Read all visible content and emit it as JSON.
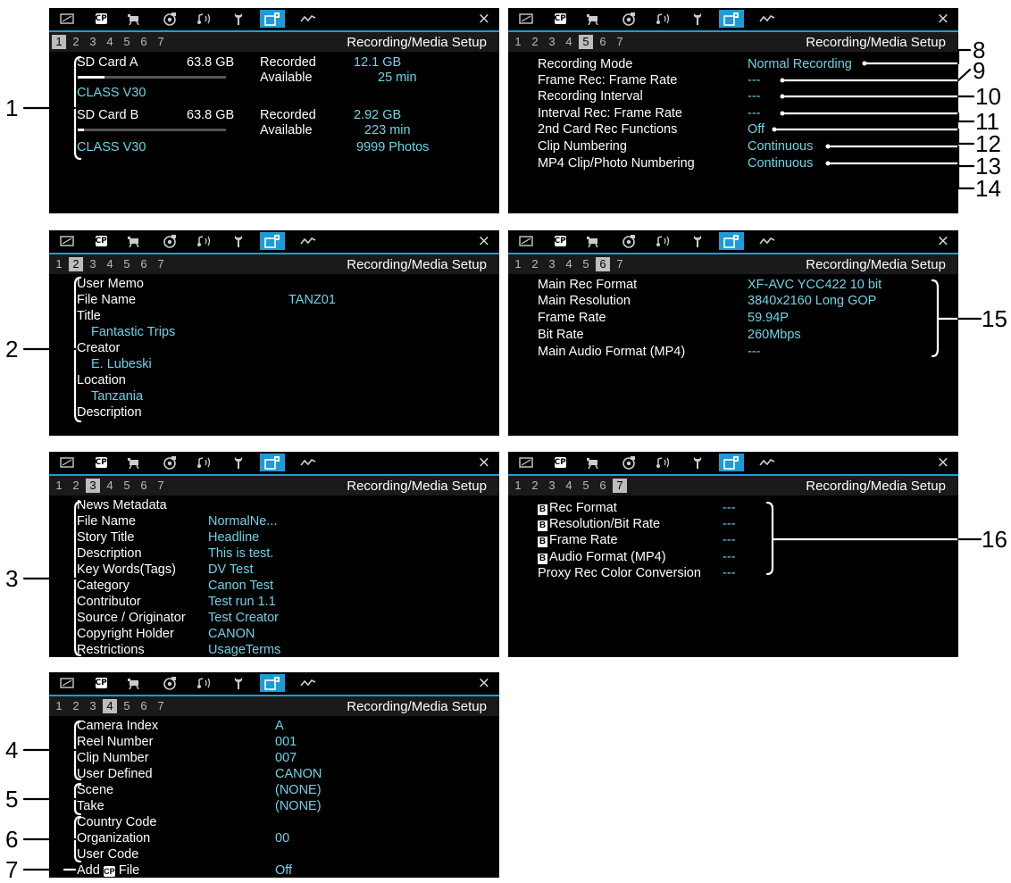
{
  "header": {
    "title": "Recording/Media Setup",
    "close": "×",
    "pages": [
      "1",
      "2",
      "3",
      "4",
      "5",
      "6",
      "7"
    ]
  },
  "tabs": [
    "display-icon",
    "cp-icon",
    "camera-icon",
    "custom-picture-icon",
    "audio-icon",
    "wrench-icon",
    "recording-media-icon",
    "assign-icon"
  ],
  "screen1": {
    "card_a": "SD Card A",
    "card_a_size": "63.8 GB",
    "card_a_fill": 0.18,
    "recorded": "Recorded",
    "available": "Available",
    "card_a_recorded": "12.1 GB",
    "card_a_available": "25 min",
    "card_a_class": "CLASS V30",
    "card_b": "SD Card B",
    "card_b_size": "63.8 GB",
    "card_b_fill": 0.04,
    "card_b_recorded": "2.92 GB",
    "card_b_available": "223 min",
    "card_b_class": "CLASS V30",
    "photos": "9999 Photos"
  },
  "screen2": {
    "user_memo": "User Memo",
    "file_name": "File Name",
    "file_name_val": "TANZ01",
    "title": "Title",
    "title_val": "Fantastic Trips",
    "creator": "Creator",
    "creator_val": "E. Lubeski",
    "location": "Location",
    "location_val": "Tanzania",
    "description": "Description"
  },
  "screen3": {
    "labels": [
      "News Metadata",
      "File Name",
      "Story Title",
      "Description",
      "Key Words(Tags)",
      "Category",
      "Contributor",
      "Source / Originator",
      "Copyright Holder",
      "Restrictions"
    ],
    "values": [
      "",
      "NormalNe...",
      "Headline",
      "This is test.",
      "DV Test",
      "Canon Test",
      "Test run 1.1",
      "Test Creator",
      "CANON",
      "UsageTerms"
    ]
  },
  "screen4": {
    "labels": [
      "Camera Index",
      "Reel Number",
      "Clip Number",
      "User Defined",
      "Scene",
      "Take",
      "Country Code",
      "Organization",
      "User Code"
    ],
    "values": [
      "A",
      "001",
      "007",
      "CANON",
      "(NONE)",
      "(NONE)",
      "",
      "00",
      ""
    ],
    "add_prefix": "Add",
    "cp_badge": "CP",
    "add_suffix": "File",
    "add_val": "Off"
  },
  "screen5": {
    "labels": [
      "Recording Mode",
      "Frame Rec: Frame Rate",
      "Recording Interval",
      "Interval Rec: Frame Rate",
      "2nd Card Rec Functions",
      "Clip Numbering",
      "MP4 Clip/Photo Numbering"
    ],
    "values": [
      "Normal Recording",
      "---",
      "---",
      "---",
      "Off",
      "Continuous",
      "Continuous"
    ]
  },
  "screen6": {
    "labels": [
      "Main Rec Format",
      "Main Resolution",
      "Frame Rate",
      "Bit Rate",
      "Main Audio Format (MP4)"
    ],
    "values": [
      "XF-AVC YCC422 10 bit",
      "3840x2160 Long GOP",
      "59.94P",
      "260Mbps",
      "---"
    ]
  },
  "screen7": {
    "badge": "B",
    "labels": [
      "Rec Format",
      "Resolution/Bit Rate",
      "Frame Rate",
      "Audio Format (MP4)",
      "Proxy Rec Color Conversion"
    ],
    "values": [
      "---",
      "---",
      "---",
      "---",
      "---"
    ]
  },
  "callouts": [
    "1",
    "2",
    "3",
    "4",
    "5",
    "6",
    "7",
    "8",
    "9",
    "10",
    "11",
    "12",
    "13",
    "14",
    "15",
    "16"
  ]
}
